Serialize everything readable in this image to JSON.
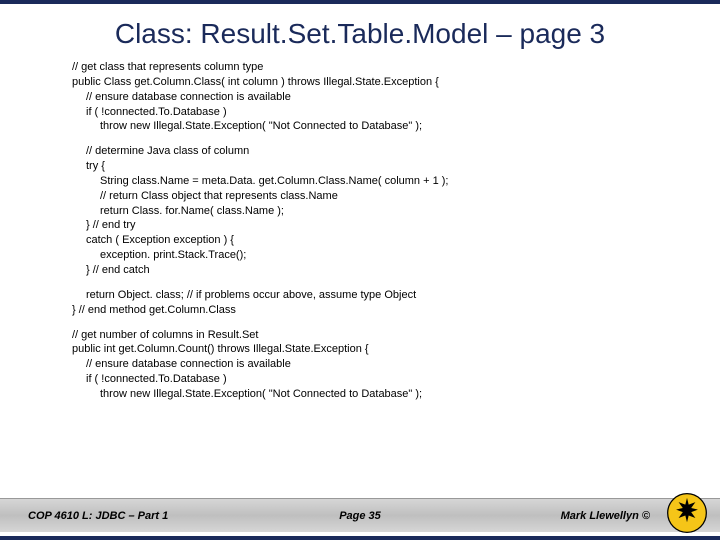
{
  "title": "Class:  Result.Set.Table.Model – page 3",
  "code": {
    "b1": {
      "l1": "// get class that represents column type",
      "l2": "public Class get.Column.Class( int column ) throws Illegal.State.Exception {",
      "l3": "// ensure database connection is available",
      "l4": "if ( !connected.To.Database )",
      "l5": "throw new Illegal.State.Exception( \"Not Connected to Database\" );"
    },
    "b2": {
      "l1": "// determine Java class of column",
      "l2": "try {",
      "l3": "String class.Name = meta.Data. get.Column.Class.Name( column + 1 );",
      "l4": "// return Class object that represents class.Name",
      "l5": "return Class. for.Name( class.Name );",
      "l6": "} // end try",
      "l7": "catch ( Exception exception ) {",
      "l8": "exception. print.Stack.Trace();",
      "l9": "} // end catch"
    },
    "b3": {
      "l1": "return Object. class; // if problems occur above, assume type Object",
      "l2": "} // end method get.Column.Class"
    },
    "b4": {
      "l1": "// get number of columns in Result.Set",
      "l2": "public int get.Column.Count() throws Illegal.State.Exception {",
      "l3": "// ensure database connection is available",
      "l4": "if ( !connected.To.Database )",
      "l5": "throw new Illegal.State.Exception( \"Not Connected to Database\" );"
    }
  },
  "footer": {
    "left": "COP 4610 L: JDBC – Part 1",
    "center": "Page 35",
    "right": "Mark Llewellyn ©"
  }
}
